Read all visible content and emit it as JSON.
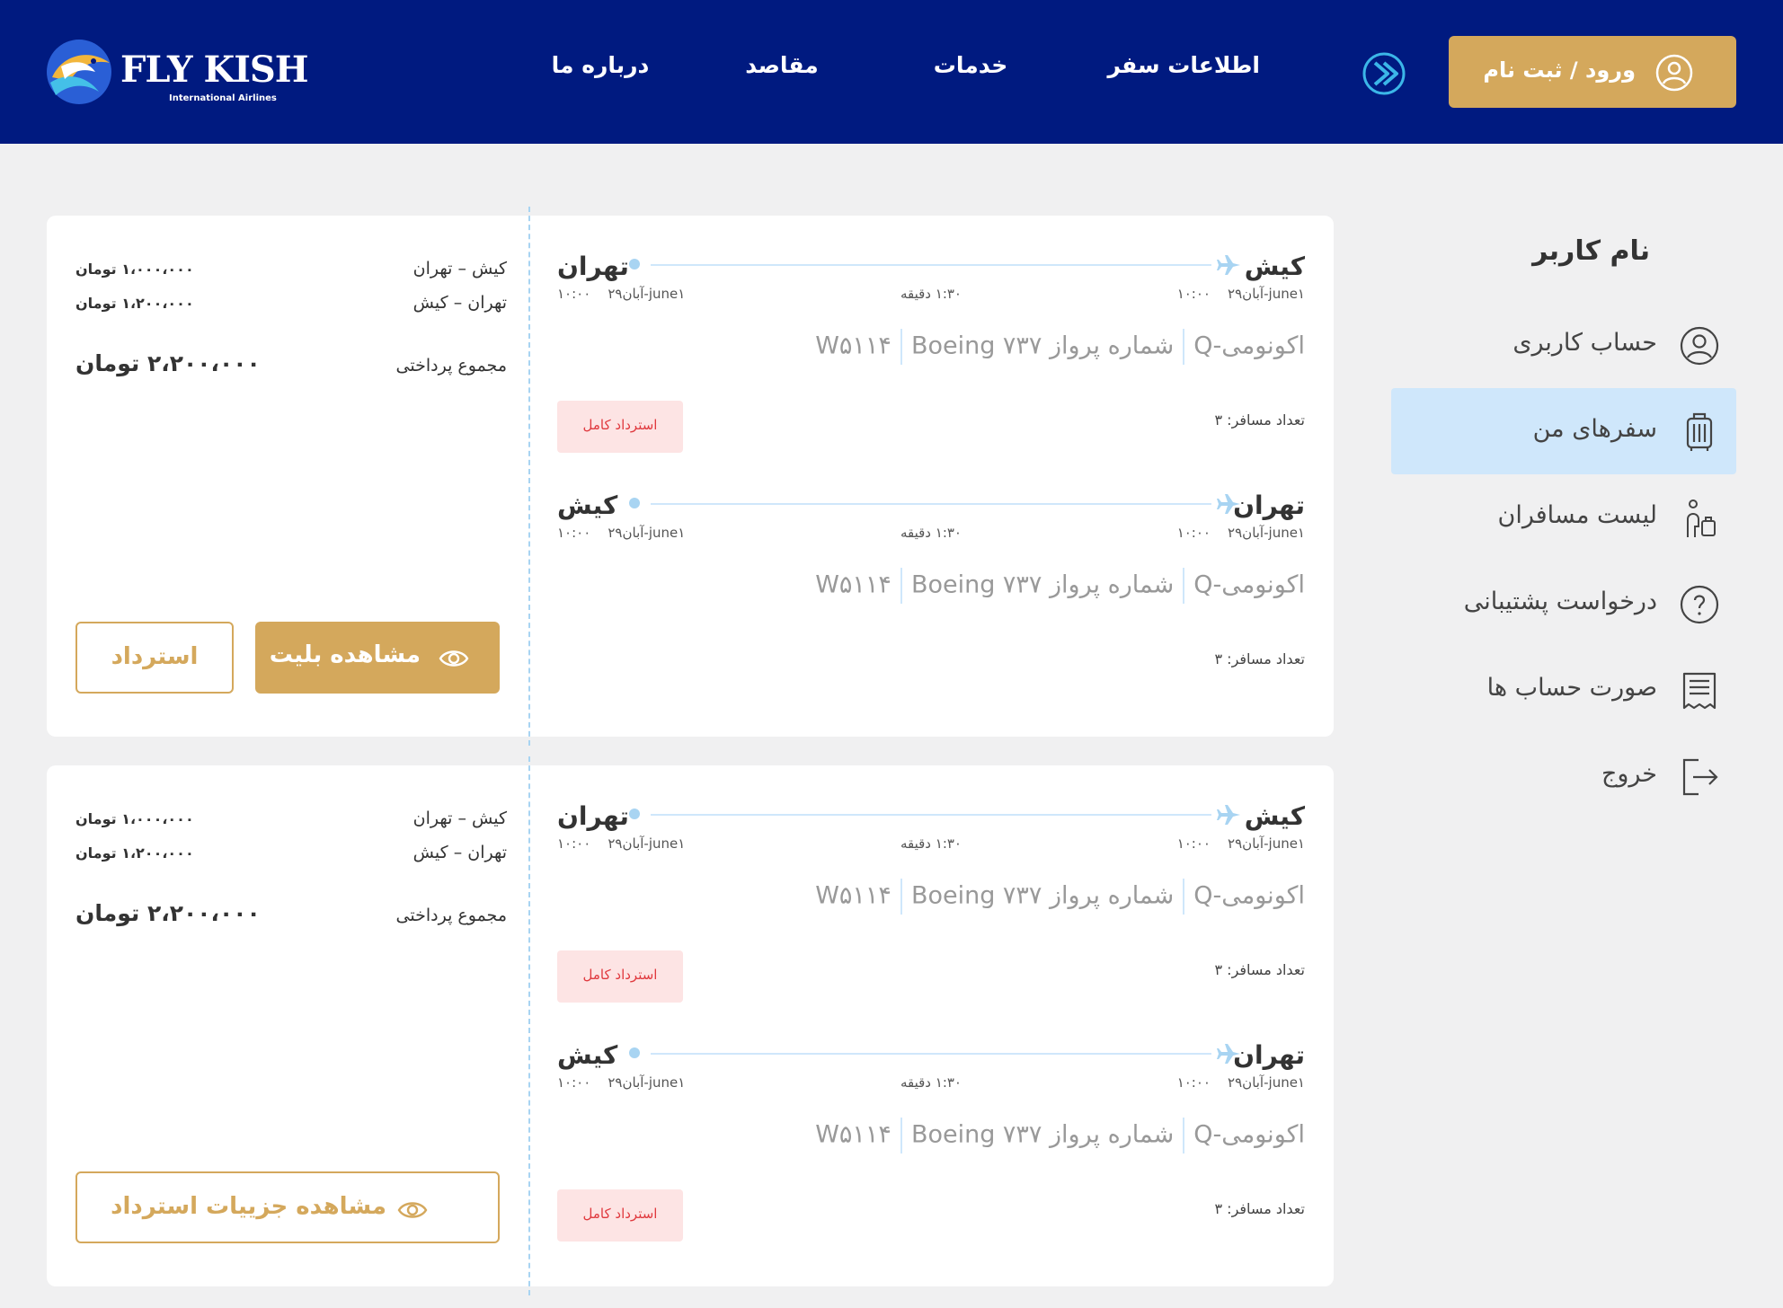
{
  "brand": {
    "name": "FLY KISH",
    "tagline": "International Airlines",
    "primary_color": "#001a80",
    "accent_color": "#d4a85c",
    "active_color": "#cfe7fb"
  },
  "header": {
    "nav": [
      "درباره ما",
      "مقاصد",
      "خدمات",
      "اطلاعات سفر"
    ],
    "icon": "circle-arrow-icon",
    "login_label": "ورود / ثبت نام",
    "login_icon": "user-icon"
  },
  "sidebar": {
    "username": "نام کاربر",
    "items": [
      {
        "label": "حساب کاربری",
        "icon": "user-circle-icon"
      },
      {
        "label": "سفرهای من",
        "icon": "luggage-icon",
        "active": true
      },
      {
        "label": "لیست مسافران",
        "icon": "traveler-icon"
      },
      {
        "label": "درخواست پشتیبانی",
        "icon": "question-circle-icon"
      },
      {
        "label": "صورت حساب ها",
        "icon": "receipt-icon"
      },
      {
        "label": "خروج",
        "icon": "logout-icon"
      }
    ]
  },
  "cards": [
    {
      "summary": {
        "rows": [
          {
            "route": "کیش – تهران",
            "price": "۱،۰۰۰،۰۰۰ تومان"
          },
          {
            "route": "تهران – کیش",
            "price": "۱،۲۰۰،۰۰۰ تومان"
          }
        ],
        "total_label": "مجموع پرداختی",
        "total_value": "۲،۲۰۰،۰۰۰ تومان"
      },
      "buttons": {
        "view": "مشاهده بلیت",
        "refund": "استرداد"
      },
      "segments": [
        {
          "from": "کیش",
          "to": "تهران",
          "dep_time": "۱۰:۰۰",
          "dep_date": "۲۹آبان-june۱",
          "duration": "۱:۳۰ دقیقه",
          "arr_date": "۲۹آبان-june۱",
          "arr_time": "۱۰:۰۰",
          "cabin": "اکونومی-Q",
          "flight": "شماره پرواز W۵۱۱۴",
          "aircraft": "Boeing ۷۳۷",
          "pax": "تعداد مسافر: ۳",
          "badge": "استرداد کامل"
        },
        {
          "from": "تهران",
          "to": "کیش",
          "dep_time": "۱۰:۰۰",
          "dep_date": "۲۹آبان-june۱",
          "duration": "۱:۳۰ دقیقه",
          "arr_date": "۲۹آبان-june۱",
          "arr_time": "۱۰:۰۰",
          "cabin": "اکونومی-Q",
          "flight": "شماره پرواز W۵۱۱۴",
          "aircraft": "Boeing ۷۳۷",
          "pax": "تعداد مسافر: ۳",
          "badge": ""
        }
      ]
    },
    {
      "summary": {
        "rows": [
          {
            "route": "کیش – تهران",
            "price": "۱،۰۰۰،۰۰۰ تومان"
          },
          {
            "route": "تهران – کیش",
            "price": "۱،۲۰۰،۰۰۰ تومان"
          }
        ],
        "total_label": "مجموع پرداختی",
        "total_value": "۲،۲۰۰،۰۰۰ تومان"
      },
      "buttons": {
        "details": "مشاهده جزییات استرداد"
      },
      "segments": [
        {
          "from": "کیش",
          "to": "تهران",
          "dep_time": "۱۰:۰۰",
          "dep_date": "۲۹آبان-june۱",
          "duration": "۱:۳۰ دقیقه",
          "arr_date": "۲۹آبان-june۱",
          "arr_time": "۱۰:۰۰",
          "cabin": "اکونومی-Q",
          "flight": "شماره پرواز W۵۱۱۴",
          "aircraft": "Boeing ۷۳۷",
          "pax": "تعداد مسافر: ۳",
          "badge": "استرداد کامل"
        },
        {
          "from": "تهران",
          "to": "کیش",
          "dep_time": "۱۰:۰۰",
          "dep_date": "۲۹آبان-june۱",
          "duration": "۱:۳۰ دقیقه",
          "arr_date": "۲۹آبان-june۱",
          "arr_time": "۱۰:۰۰",
          "cabin": "اکونومی-Q",
          "flight": "شماره پرواز W۵۱۱۴",
          "aircraft": "Boeing ۷۳۷",
          "pax": "تعداد مسافر: ۳",
          "badge": "استرداد کامل"
        }
      ]
    }
  ]
}
